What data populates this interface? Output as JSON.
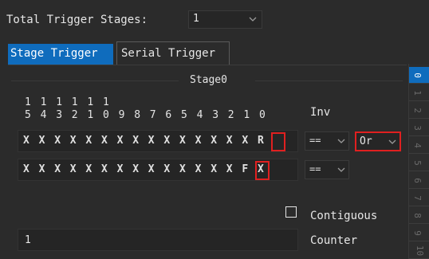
{
  "top": {
    "label": "Total Trigger Stages:",
    "value": "1",
    "chevron_icon": "chevron-down-icon"
  },
  "tabs": {
    "stage": "Stage Trigger",
    "serial": "Serial Trigger"
  },
  "group": {
    "title": "Stage0"
  },
  "header": {
    "tens": [
      "1",
      "1",
      "1",
      "1",
      "1",
      "1"
    ],
    "units": [
      "5",
      "4",
      "3",
      "2",
      "1",
      "0",
      "9",
      "8",
      "7",
      "6",
      "5",
      "4",
      "3",
      "2",
      "1",
      "0"
    ],
    "inv_label": "Inv"
  },
  "rows": [
    {
      "bits": [
        "X",
        "X",
        "X",
        "X",
        "X",
        "X",
        "X",
        "X",
        "X",
        "X",
        "X",
        "X",
        "X",
        "X",
        "X",
        "R"
      ],
      "op": "==",
      "logic": "Or"
    },
    {
      "bits": [
        "X",
        "X",
        "X",
        "X",
        "X",
        "X",
        "X",
        "X",
        "X",
        "X",
        "X",
        "X",
        "X",
        "X",
        "F",
        "X"
      ],
      "op": "=="
    }
  ],
  "options": {
    "contiguous_label": "Contiguous",
    "contiguous_checked": false
  },
  "counter": {
    "value": "1",
    "label": "Counter"
  },
  "stage_tabs": [
    "0",
    "1",
    "2",
    "3",
    "4",
    "5",
    "6",
    "7",
    "8",
    "9",
    "10"
  ],
  "colors": {
    "accent": "#0f6cbd",
    "highlight": "#e02020",
    "background": "#2b2b2b"
  }
}
